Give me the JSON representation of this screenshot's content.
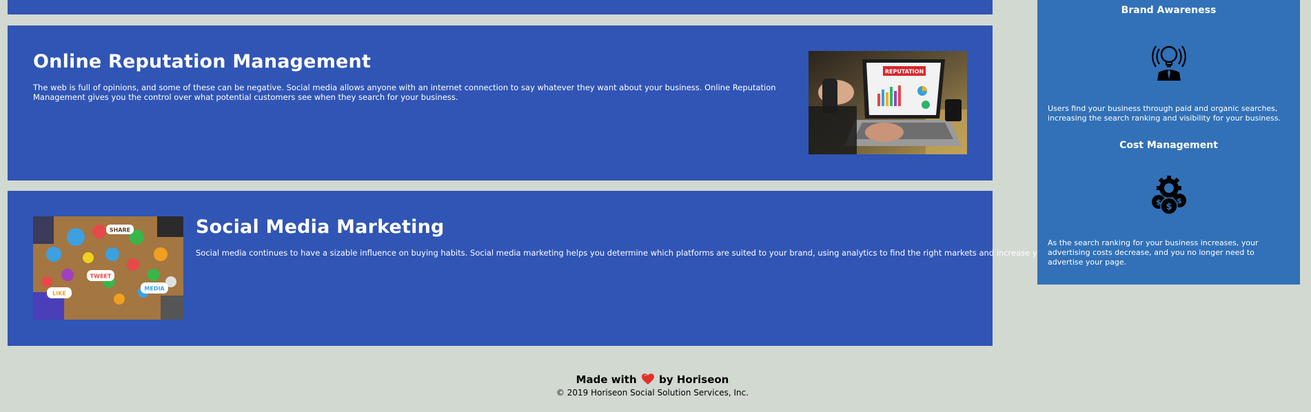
{
  "services": [
    {
      "title": "Online Reputation Management",
      "description": "The web is full of opinions, and some of these can be negative. Social media allows anyone with an internet connection to say whatever they want about your business. Online Reputation Management gives you the control over what potential customers see when they search for your business.",
      "image_label": "REPUTATION"
    },
    {
      "title": "Social Media Marketing",
      "description": "Social media continues to have a sizable influence on buying habits. Social media marketing helps you determine which platforms are suited to your brand, using analytics to find the right markets and increase your lead generation.",
      "image_labels": [
        "SHARE",
        "TWEET",
        "LIKE",
        "MEDIA"
      ]
    }
  ],
  "benefits": [
    {
      "heading": "Brand Awareness",
      "icon": "lightbulb-person-icon",
      "text": "Users find your business through paid and organic searches, increasing the search ranking and visibility for your business."
    },
    {
      "heading": "Cost Management",
      "icon": "money-gear-icon",
      "text": "As the search ranking for your business increases, your advertising costs decrease, and you no longer need to advertise your page."
    }
  ],
  "footer": {
    "made_with": "Made with",
    "by": "by Horiseon",
    "copyright": "© 2019 Horiseon Social Solution Services, Inc."
  },
  "colors": {
    "page_background": "#d2d9d1",
    "card_background": "#3055b5",
    "sidebar_background": "#3271b7",
    "heart": "#e0322a"
  }
}
